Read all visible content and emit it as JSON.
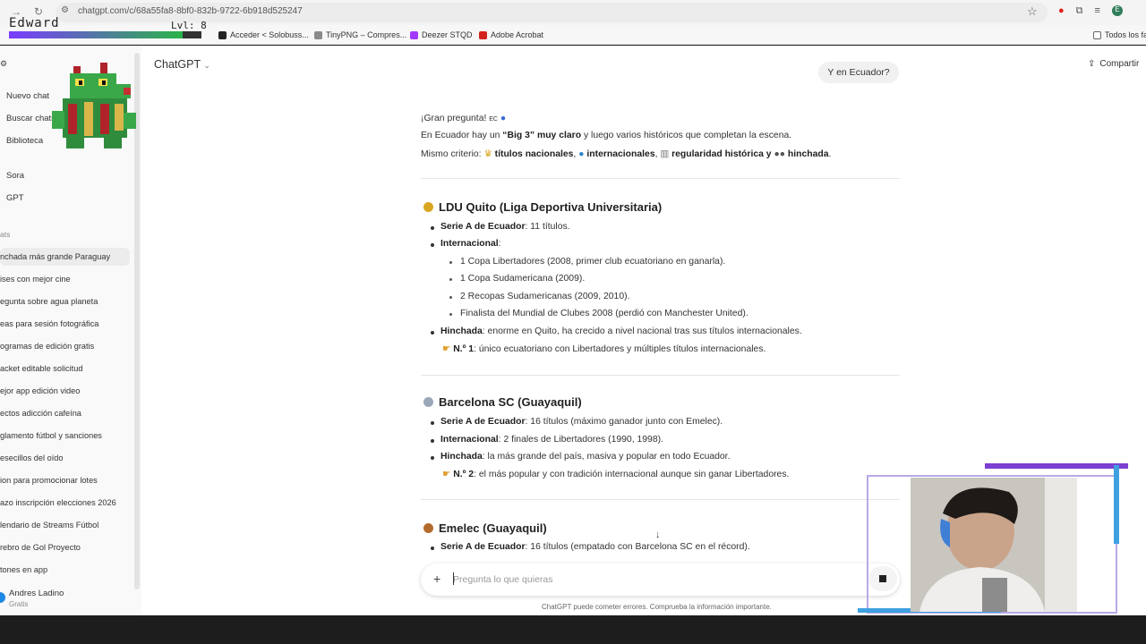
{
  "browser": {
    "url": "chatgpt.com/c/68a55fa8-8bf0-832b-9722-6b918d525247",
    "bookmarks": [
      "Acceder < Solobuss...",
      "TinyPNG – Compres...",
      "Deezer STQD",
      "Adobe Acrobat"
    ],
    "bookmarks_folder": "Todos los fa"
  },
  "stream": {
    "name": "Edward",
    "level": "Lvl: 8",
    "xp_fraction": 0.9
  },
  "sidebar": {
    "top_items": [
      "Nuevo chat",
      "Buscar chats",
      "Biblioteca"
    ],
    "gpts": [
      "Sora",
      "GPT"
    ],
    "section_label": "ats",
    "chats": [
      "nchada más grande Paraguay",
      "ises con mejor cine",
      "egunta sobre agua planeta",
      "eas para sesión fotográfica",
      "ogramas de edición gratis",
      "acket editable solicitud",
      "ejor app edición video",
      "ectos adicción cafeína",
      "glamento fútbol y sanciones",
      "esecillos del oído",
      "ion para promocionar lotes",
      "azo inscripción elecciones 2026",
      "lendario de Streams Fútbol",
      "rebro de Gol Proyecto",
      "tones en app"
    ],
    "user_name": "Andres Ladino",
    "user_plan": "Gratis"
  },
  "header": {
    "model": "ChatGPT",
    "share": "Compartir"
  },
  "user_message": "Y en Ecuador?",
  "answer": {
    "intro1": "¡Gran pregunta! ",
    "intro1_flag": "EC",
    "intro2_pre": "En Ecuador hay un ",
    "intro2_bold": "“Big 3” muy claro",
    "intro2_post": " y luego varios históricos que completan la escena.",
    "criteria_pre": "Mismo criterio: ",
    "criteria_1": "títulos nacionales",
    "criteria_2": "internacionales",
    "criteria_3": "regularidad histórica y",
    "criteria_4": "hinchada",
    "ldu": {
      "title": "LDU Quito (Liga Deportiva Universitaria)",
      "serie_label": "Serie A de Ecuador",
      "serie_text": ": 11 títulos.",
      "intl_label": "Internacional",
      "intl_text": ":",
      "sub": [
        "1 Copa Libertadores (2008, primer club ecuatoriano en ganarla).",
        "1 Copa Sudamericana (2009).",
        "2 Recopas Sudamericanas (2009, 2010).",
        "Finalista del Mundial de Clubes 2008 (perdió con Manchester United)."
      ],
      "hinchada_label": "Hinchada",
      "hinchada_text": ": enorme en Quito, ha crecido a nivel nacional tras sus títulos internacionales.",
      "rank_label": "N.º 1",
      "rank_text": ": único ecuatoriano con Libertadores y múltiples títulos internacionales."
    },
    "barcelona": {
      "title": "Barcelona SC (Guayaquil)",
      "serie_label": "Serie A de Ecuador",
      "serie_text": ": 16 títulos (máximo ganador junto con Emelec).",
      "intl_label": "Internacional",
      "intl_text": ": 2 finales de Libertadores (1990, 1998).",
      "hinchada_label": "Hinchada",
      "hinchada_text": ": la más grande del país, masiva y popular en todo Ecuador.",
      "rank_label": "N.º 2",
      "rank_text": ": el más popular y con tradición internacional aunque sin ganar Libertadores."
    },
    "emelec": {
      "title": "Emelec (Guayaquil)",
      "serie_label": "Serie A de Ecuador",
      "serie_text": ": 16 títulos (empatado con Barcelona SC en el récord)."
    }
  },
  "composer": {
    "placeholder": "Pregunta lo que quieras"
  },
  "footer_note": "ChatGPT puede cometer errores. Comprueba la información importante.",
  "colors": {
    "gold": "#d9a520",
    "silver": "#9aa7b8",
    "bronze": "#b36b2c",
    "accent_blue": "#1e88e5"
  }
}
